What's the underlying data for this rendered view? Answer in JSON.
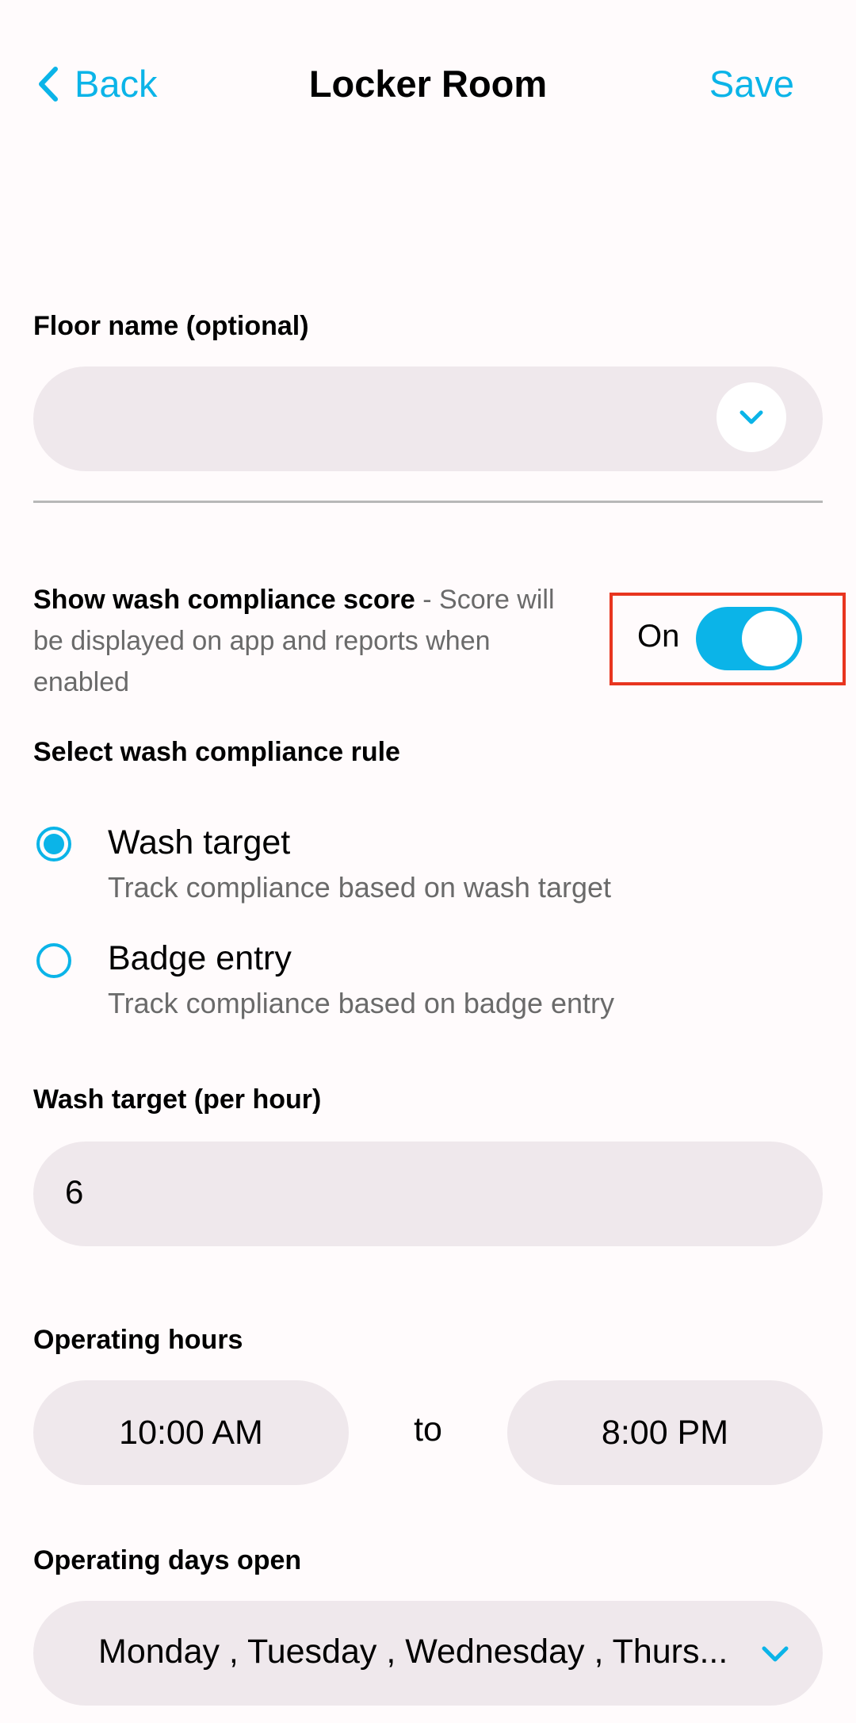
{
  "header": {
    "back_label": "Back",
    "title": "Locker Room",
    "save_label": "Save"
  },
  "floor": {
    "label": "Floor name (optional)",
    "value": ""
  },
  "compliance_score": {
    "title": "Show wash compliance score",
    "separator": " - ",
    "description": "Score will be displayed on app and reports when enabled",
    "toggle_label": "On",
    "enabled": true
  },
  "rule": {
    "label": "Select wash compliance rule",
    "options": [
      {
        "title": "Wash target",
        "subtitle": "Track compliance based on wash target",
        "selected": true
      },
      {
        "title": "Badge entry",
        "subtitle": "Track compliance based on badge entry",
        "selected": false
      }
    ]
  },
  "wash_target": {
    "label": "Wash target (per hour)",
    "value": "6"
  },
  "operating_hours": {
    "label": "Operating hours",
    "start": "10:00 AM",
    "to_label": "to",
    "end": "8:00 PM"
  },
  "operating_days": {
    "label": "Operating days open",
    "value": "Monday , Tuesday , Wednesday , Thurs..."
  },
  "colors": {
    "accent": "#0bb4e8",
    "field_bg": "#efe8ec",
    "highlight": "#e8351f"
  }
}
